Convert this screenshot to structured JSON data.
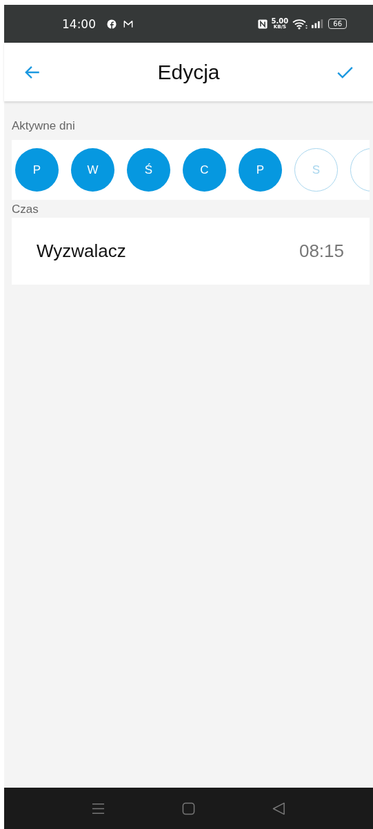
{
  "status_bar": {
    "time": "14:00",
    "speed_value": "5.00",
    "speed_unit": "KB/S",
    "battery": "66"
  },
  "header": {
    "title": "Edycja"
  },
  "active_days": {
    "label": "Aktywne dni",
    "days": [
      {
        "label": "P",
        "selected": true
      },
      {
        "label": "W",
        "selected": true
      },
      {
        "label": "Ś",
        "selected": true
      },
      {
        "label": "C",
        "selected": true
      },
      {
        "label": "P",
        "selected": true
      },
      {
        "label": "S",
        "selected": false
      },
      {
        "selected": false
      }
    ]
  },
  "time_section": {
    "label": "Czas",
    "rows": [
      {
        "label": "Wyzwalacz",
        "value": "08:15"
      }
    ]
  }
}
